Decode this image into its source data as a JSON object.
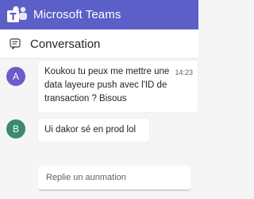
{
  "app": {
    "title": "Microsoft Teams",
    "brand_color": "#5b5fc7"
  },
  "icons": {
    "logo": "teams-logo-icon",
    "chat": "chat-icon"
  },
  "header": {
    "title": "Conversation"
  },
  "messages": [
    {
      "avatar": "A",
      "avatar_color": "#6b5cc9",
      "text": "Koukou tu peux me mettre une data layeure push avec l'ID de transaction ? Bisous",
      "time": "14:23"
    },
    {
      "avatar": "B",
      "avatar_color": "#3a8a72",
      "text": "Ui dakor sé en prod lol"
    }
  ],
  "compose": {
    "placeholder": "Replie un aunmation"
  }
}
